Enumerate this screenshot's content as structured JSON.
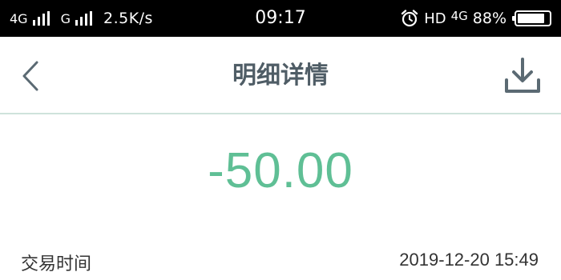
{
  "status_bar": {
    "network_1": "4G",
    "network_2": "G",
    "speed": "2.5K/s",
    "time": "09:17",
    "alarm_icon": "alarm-clock-icon",
    "hd": "HD",
    "network_3": "4G",
    "battery_percent": "88%",
    "battery_level": 0.88
  },
  "nav": {
    "back_icon": "chevron-left-icon",
    "title": "明细详情",
    "download_icon": "download-icon"
  },
  "transaction": {
    "amount": "-50.00",
    "amount_color": "#5fbf95",
    "time_label": "交易时间",
    "time_value": "2019-12-20 15:49"
  }
}
